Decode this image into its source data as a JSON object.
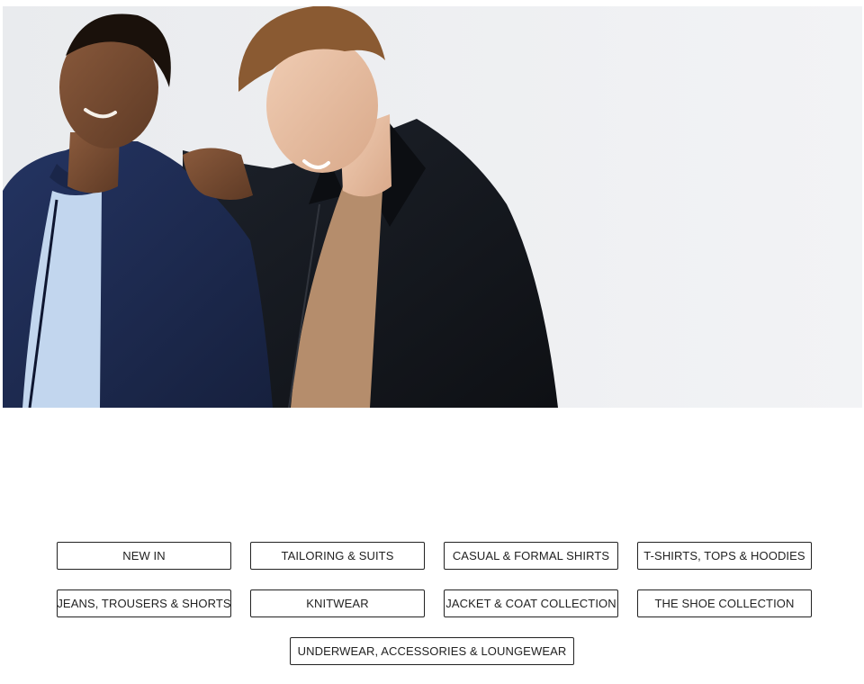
{
  "hero": {
    "image": "two-men-jackets-photo",
    "colors": {
      "backdrop": "#eef0f2",
      "navy_jacket": "#1c2a4f",
      "black_jacket": "#14171d",
      "light_blue_tee": "#c2d6ee",
      "tan_tee": "#b58d6c"
    }
  },
  "categories": [
    {
      "label": "NEW IN"
    },
    {
      "label": "TAILORING & SUITS"
    },
    {
      "label": "CASUAL & FORMAL SHIRTS"
    },
    {
      "label": "T-SHIRTS, TOPS & HOODIES"
    },
    {
      "label": "JEANS, TROUSERS & SHORTS"
    },
    {
      "label": "KNITWEAR"
    },
    {
      "label": "JACKET & COAT COLLECTION"
    },
    {
      "label": "THE SHOE COLLECTION"
    },
    {
      "label": "UNDERWEAR, ACCESSORIES & LOUNGEWEAR"
    }
  ]
}
